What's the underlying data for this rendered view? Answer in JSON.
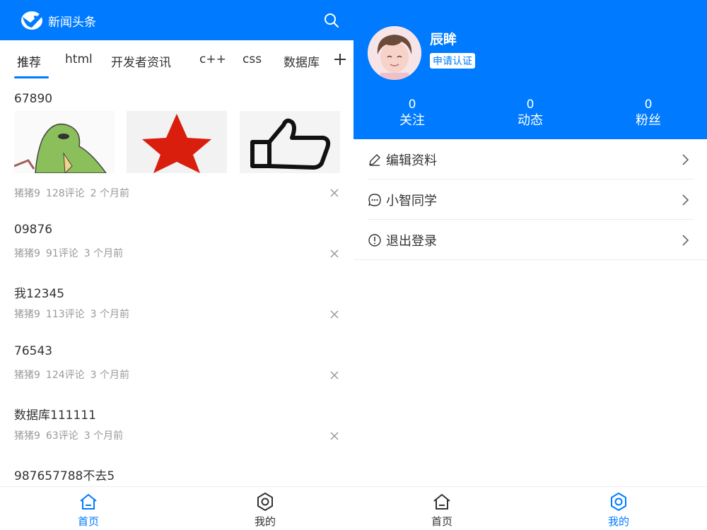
{
  "colors": {
    "primary": "#007bff",
    "text": "#333333",
    "meta": "#999999",
    "inactive": "#333333"
  },
  "feed_screen": {
    "header": {
      "title": "新闻头条",
      "logo_icon": "bird-logo-icon",
      "search_icon": "search-icon"
    },
    "tabs": [
      {
        "label": "推荐",
        "active": true
      },
      {
        "label": "html"
      },
      {
        "label": "开发者资讯"
      },
      {
        "label": "c++"
      },
      {
        "label": "css"
      },
      {
        "label": "数据库"
      }
    ],
    "add_tab_icon": "plus-icon",
    "articles": [
      {
        "title": "67890",
        "author": "猪猪9",
        "comments": "128评论",
        "time": "2 个月前",
        "images": [
          "dinosaur-image",
          "red-star-image",
          "thumbs-up-image"
        ]
      },
      {
        "title": "09876",
        "author": "猪猪9",
        "comments": "91评论",
        "time": "3 个月前"
      },
      {
        "title": "我12345",
        "author": "猪猪9",
        "comments": "113评论",
        "time": "3 个月前"
      },
      {
        "title": "76543",
        "author": "猪猪9",
        "comments": "124评论",
        "time": "3 个月前"
      },
      {
        "title": "数据库111111",
        "author": "猪猪9",
        "comments": "63评论",
        "time": "3 个月前"
      },
      {
        "title": "987657788不去5"
      }
    ],
    "tabbar": [
      {
        "label": "首页",
        "icon": "home-icon",
        "active": true
      },
      {
        "label": "我的",
        "icon": "gear-icon",
        "active": false
      }
    ]
  },
  "profile_screen": {
    "user": {
      "name": "辰眸",
      "badge": "申请认证",
      "avatar": "avatar"
    },
    "stats": [
      {
        "value": "0",
        "label": "关注"
      },
      {
        "value": "0",
        "label": "动态"
      },
      {
        "value": "0",
        "label": "粉丝"
      }
    ],
    "menu": [
      {
        "label": "编辑资料",
        "icon": "pencil-icon"
      },
      {
        "label": "小智同学",
        "icon": "chat-bubble-icon"
      },
      {
        "label": "退出登录",
        "icon": "exclamation-circle-icon"
      }
    ],
    "tabbar": [
      {
        "label": "首页",
        "icon": "home-icon",
        "active": false
      },
      {
        "label": "我的",
        "icon": "gear-icon",
        "active": true
      }
    ]
  }
}
